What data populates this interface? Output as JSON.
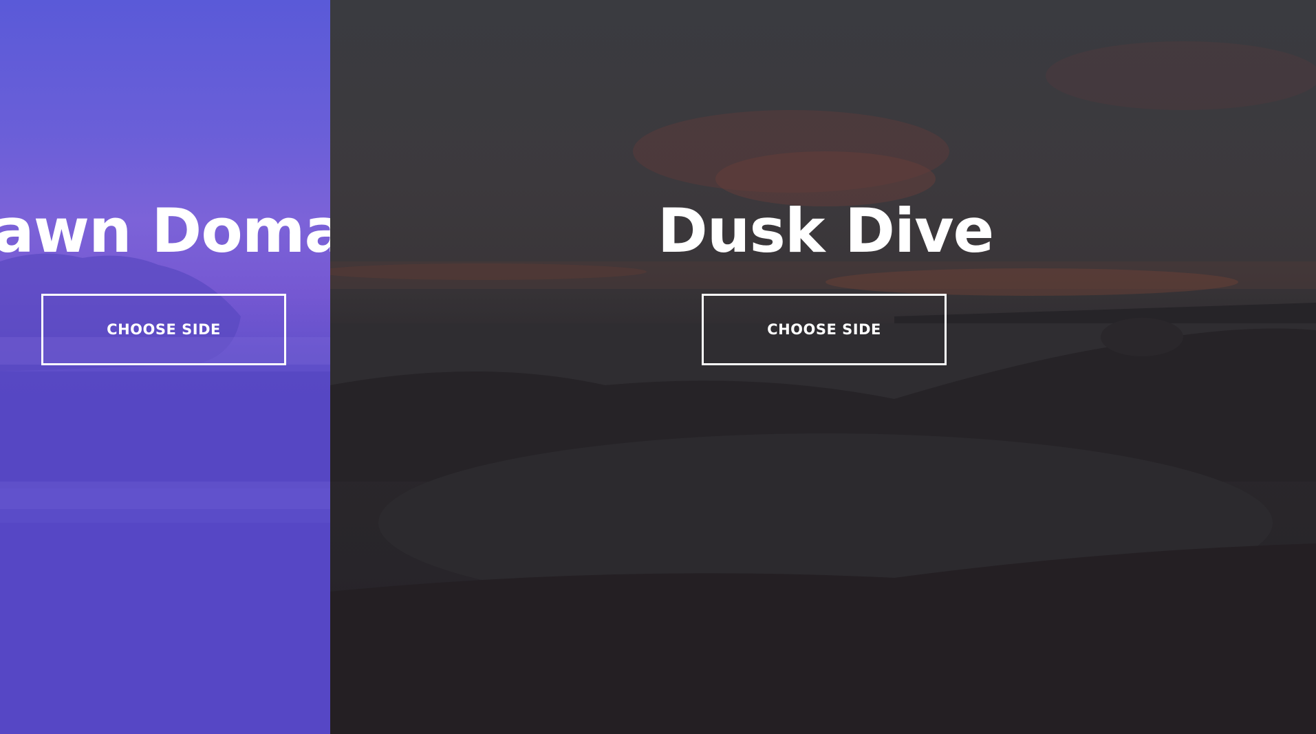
{
  "panels": {
    "dawn": {
      "title": "Dawn Domain",
      "button_label": "CHOOSE SIDE",
      "overlay_color": "#5a4cc8"
    },
    "dusk": {
      "title": "Dusk Dive",
      "button_label": "CHOOSE SIDE",
      "overlay_color": "#2a272b"
    }
  }
}
